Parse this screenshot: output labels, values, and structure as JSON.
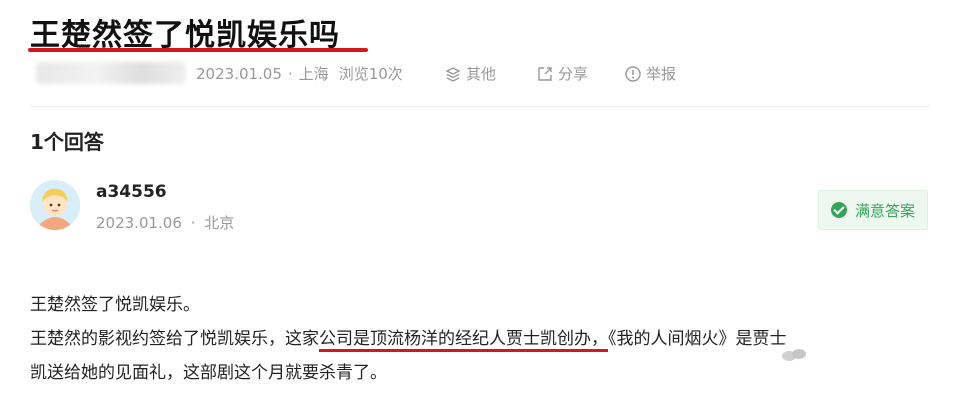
{
  "question": {
    "title": "王楚然签了悦凯娱乐吗",
    "date": "2023.01.05",
    "location": "上海",
    "views": "浏览10次",
    "actions": {
      "other": "其他",
      "share": "分享",
      "report": "举报"
    }
  },
  "answers_count": "1个回答",
  "answer": {
    "username": "a34556",
    "date": "2023.01.06",
    "location": "北京",
    "badge": "满意答案",
    "line1": "王楚然签了悦凯娱乐。",
    "line2_pre": "王楚然的影视约签给了悦凯娱乐，这家",
    "line2_highlight": "公司是顶流杨洋的经纪人贾士凯创办，",
    "line2_post": "《我的人间烟火》是贾士",
    "line3": "凯送给她的见面礼，这部剧这个月就要杀青了。"
  },
  "colors": {
    "underline": "#d4161e",
    "badge_green": "#35a45a",
    "meta_gray": "#999999"
  }
}
